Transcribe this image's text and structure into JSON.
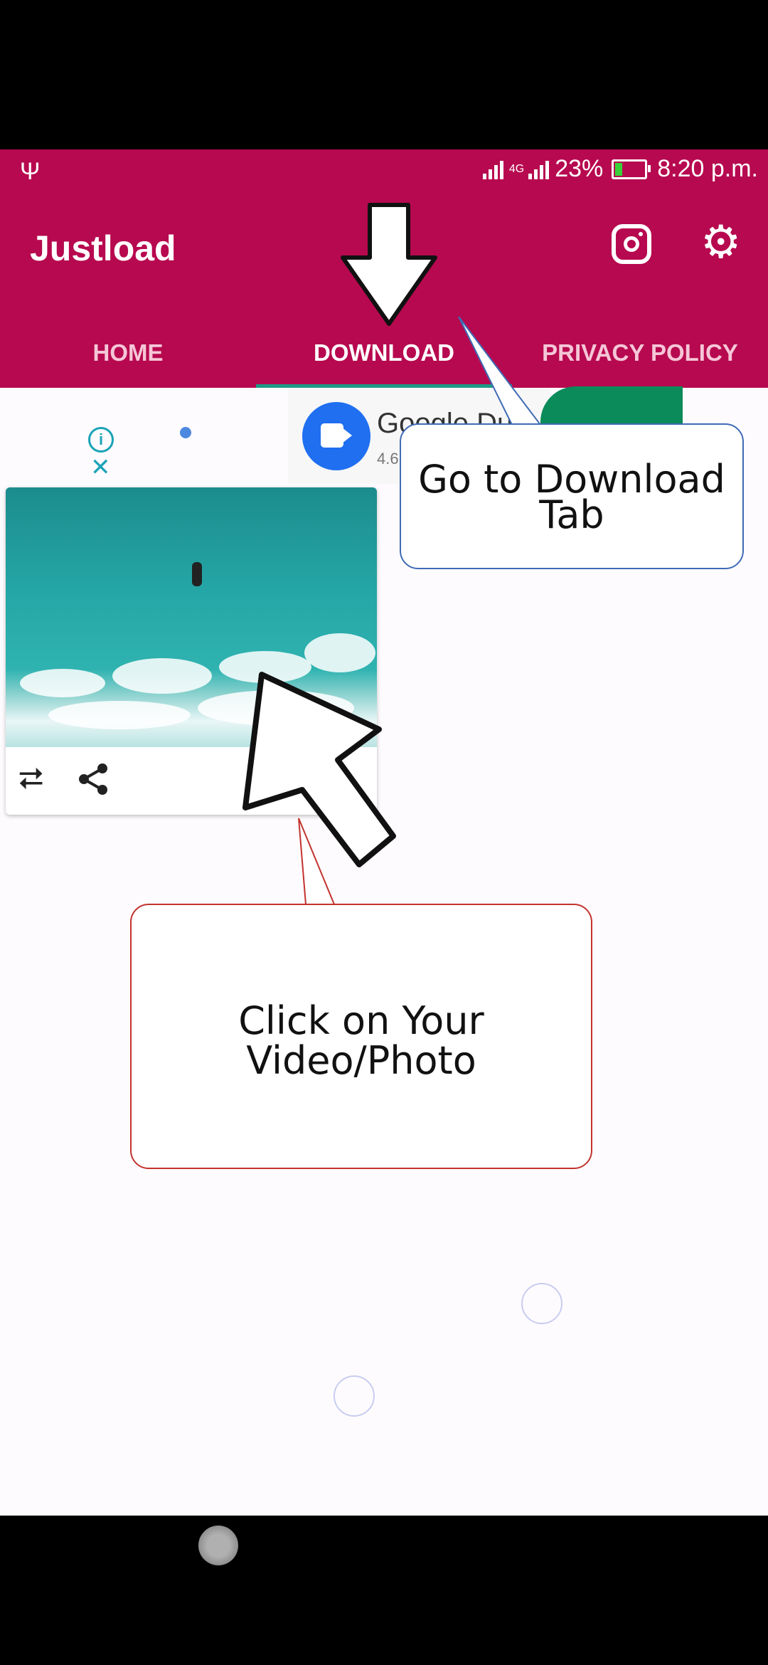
{
  "status_bar": {
    "usb_symbol": "Ψ",
    "network": "4G",
    "battery": "23%",
    "battery_level": 0.23,
    "time": "8:20 p.m."
  },
  "app": {
    "title": "Justload"
  },
  "header_icons": [
    "instagram-icon",
    "gear-icon"
  ],
  "tabs": [
    {
      "label": "HOME",
      "active": false
    },
    {
      "label": "DOWNLOAD",
      "active": true
    },
    {
      "label": "PRIVACY POLICY",
      "active": false
    }
  ],
  "ad": {
    "app_name": "Google Du",
    "rating": "4.6",
    "info_symbol": "i",
    "close_symbol": "✕"
  },
  "post_actions": {
    "repost_symbol": "⮂"
  },
  "callouts": {
    "download_tab": [
      "Go to Download",
      "Tab"
    ],
    "click_item": [
      "Click on Your",
      "Video/Photo"
    ]
  },
  "colors": {
    "appbar": "#b7094f",
    "tab_indicator": "#1e9a86",
    "content_bg": "#fefbfe",
    "callout_blue": "#3f6bb5",
    "callout_red": "#c2332e"
  }
}
